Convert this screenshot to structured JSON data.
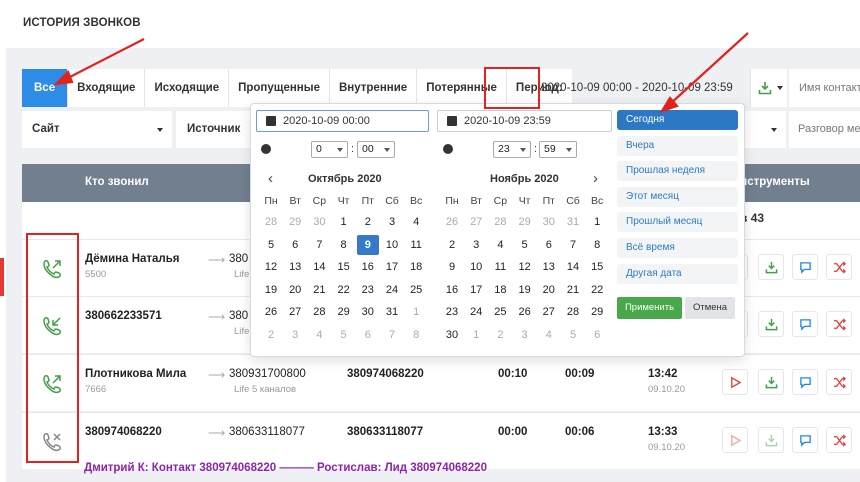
{
  "page": {
    "title": "ИСТОРИЯ ЗВОНКОВ"
  },
  "filters": {
    "tabs": [
      "Все",
      "Входящие",
      "Исходящие",
      "Пропущенные",
      "Внутренние",
      "Потерянные"
    ],
    "period_label": "Период:",
    "period_value": "2020-10-09 00:00 - 2020-10-09 23:59",
    "contact_placeholder": "Имя контакта",
    "site_label": "Сайт",
    "source_label": "Источник",
    "talk_placeholder": "Разговор между"
  },
  "table": {
    "col_who": "Кто звонил",
    "col_tools": "Инструменты",
    "total_prefix": "в",
    "total": "43",
    "rows": [
      {
        "type": "outgoing",
        "caller": "Дёмина Наталья",
        "caller_sub": "5500",
        "to": "380",
        "to_sub": "Life",
        "answered": "",
        "wait": "",
        "duration": "",
        "time": "",
        "date": ""
      },
      {
        "type": "incoming",
        "caller": "380662233571",
        "caller_sub": "",
        "to": "380",
        "to_sub": "Life",
        "answered": "",
        "wait": "",
        "duration": "",
        "time": "",
        "date": ""
      },
      {
        "type": "outgoing",
        "caller": "Плотникова Мила",
        "caller_sub": "7666",
        "to": "380931700800",
        "to_sub": "Life 5 каналов",
        "answered": "380974068220",
        "wait": "00:10",
        "duration": "00:09",
        "time": "13:42",
        "date": "09.10.20"
      },
      {
        "type": "missed",
        "caller": "380974068220",
        "caller_sub": "",
        "to": "380633118077",
        "to_sub": "",
        "answered": "380633118077",
        "wait": "00:00",
        "duration": "00:06",
        "time": "13:33",
        "date": "09.10.20"
      }
    ],
    "note": "Дмитрий К: Контакт 380974068220 ——— Ростислав: Лид 380974068220",
    "arrow_glyph": "⟶"
  },
  "picker": {
    "start_datetime": "2020-10-09 00:00",
    "end_datetime": "2020-10-09 23:59",
    "start_hour": "0",
    "start_min": "00",
    "end_hour": "23",
    "end_min": "59",
    "left_month": "Октябрь 2020",
    "right_month": "Ноябрь 2020",
    "weekdays": [
      "Пн",
      "Вт",
      "Ср",
      "Чт",
      "Пт",
      "Сб",
      "Вс"
    ],
    "left_days": [
      "28",
      "29",
      "30",
      "1",
      "2",
      "3",
      "4",
      "5",
      "6",
      "7",
      "8",
      "9",
      "10",
      "11",
      "12",
      "13",
      "14",
      "15",
      "16",
      "17",
      "18",
      "19",
      "20",
      "21",
      "22",
      "23",
      "24",
      "25",
      "26",
      "27",
      "28",
      "29",
      "30",
      "31",
      "1",
      "2",
      "3",
      "4",
      "5",
      "6",
      "7",
      "8"
    ],
    "left_days_off": [
      0,
      1,
      2,
      34,
      35,
      36,
      37,
      38,
      39,
      40,
      41
    ],
    "left_selected_index": 11,
    "right_days": [
      "26",
      "27",
      "28",
      "29",
      "30",
      "31",
      "1",
      "2",
      "3",
      "4",
      "5",
      "6",
      "7",
      "8",
      "9",
      "10",
      "11",
      "12",
      "13",
      "14",
      "15",
      "16",
      "17",
      "18",
      "19",
      "20",
      "21",
      "22",
      "23",
      "24",
      "25",
      "26",
      "27",
      "28",
      "29",
      "30",
      "1",
      "2",
      "3",
      "4",
      "5",
      "6"
    ],
    "right_days_off": [
      0,
      1,
      2,
      3,
      4,
      5,
      36,
      37,
      38,
      39,
      40,
      41
    ],
    "ranges": [
      "Сегодня",
      "Вчера",
      "Прошлая неделя",
      "Этот месяц",
      "Прошлый месяц",
      "Всё время",
      "Другая дата"
    ],
    "active_range": "Сегодня",
    "apply_label": "Применить",
    "cancel_label": "Отмена",
    "prev_glyph": "‹",
    "next_glyph": "›"
  },
  "colors": {
    "accent": "#2d8ce8",
    "annotation": "#e0231c",
    "apply": "#49a84a",
    "note": "#8e24aa",
    "call_icon": "#43a047",
    "missed_icon": "#888888"
  }
}
